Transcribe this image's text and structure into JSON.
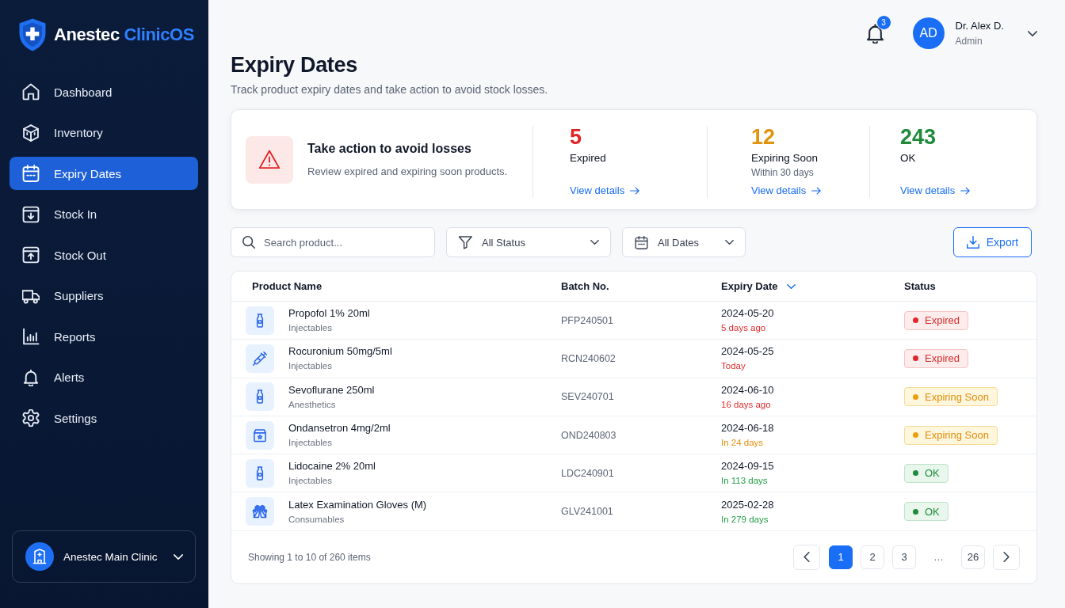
{
  "brand": {
    "name": "Anestec",
    "product": "ClinicOS"
  },
  "sidebar": {
    "items": [
      {
        "label": "Dashboard",
        "selected": false
      },
      {
        "label": "Inventory",
        "selected": false
      },
      {
        "label": "Expiry Dates",
        "selected": true
      },
      {
        "label": "Stock In",
        "selected": false
      },
      {
        "label": "Stock Out",
        "selected": false
      },
      {
        "label": "Suppliers",
        "selected": false
      },
      {
        "label": "Reports",
        "selected": false
      },
      {
        "label": "Alerts",
        "selected": false
      },
      {
        "label": "Settings",
        "selected": false
      }
    ],
    "clinic": {
      "name": "Anestec Main Clinic"
    }
  },
  "header": {
    "notifications": {
      "count": "3"
    },
    "user": {
      "initials": "AD",
      "name": "Dr. Alex D.",
      "role": "Admin"
    }
  },
  "page": {
    "title": "Expiry Dates",
    "subtitle": "Track product expiry dates and take action to avoid stock losses."
  },
  "alert": {
    "title": "Take action to avoid losses",
    "message": "Review expired and expiring soon products.",
    "stats": [
      {
        "kind": "expired",
        "value": "5",
        "label": "Expired",
        "link": "View details"
      },
      {
        "kind": "soon",
        "value": "12",
        "label": "Expiring Soon",
        "note": "Within 30 days",
        "link": "View details"
      },
      {
        "kind": "ok",
        "value": "243",
        "label": "OK",
        "link": "View details"
      }
    ]
  },
  "toolbar": {
    "search": {
      "placeholder": "Search product..."
    },
    "filters": [
      {
        "label": "All Status"
      },
      {
        "label": "All Dates"
      }
    ],
    "export": {
      "label": "Export"
    }
  },
  "table": {
    "columns": [
      {
        "label": "Product Name",
        "sorted": false
      },
      {
        "label": "Batch No.",
        "sorted": false
      },
      {
        "label": "Expiry Date",
        "sorted": true
      },
      {
        "label": "Status",
        "sorted": false
      }
    ],
    "rows": [
      {
        "name": "Propofol 1% 20ml",
        "category": "Injectables",
        "batch": "PFP240501",
        "expiry": {
          "date": "2024-05-20",
          "note": {
            "text": "5 days ago",
            "kind": "danger"
          }
        },
        "status": {
          "label": "Expired",
          "kind": "expired"
        }
      },
      {
        "name": "Rocuronium 50mg/5ml",
        "category": "Injectables",
        "batch": "RCN240602",
        "expiry": {
          "date": "2024-05-25",
          "note": {
            "text": "Today",
            "kind": "danger"
          }
        },
        "status": {
          "label": "Expired",
          "kind": "expired"
        }
      },
      {
        "name": "Sevoflurane 250ml",
        "category": "Anesthetics",
        "batch": "SEV240701",
        "expiry": {
          "date": "2024-06-10",
          "note": {
            "text": "16 days ago",
            "kind": "danger"
          }
        },
        "status": {
          "label": "Expiring Soon",
          "kind": "soon"
        }
      },
      {
        "name": "Ondansetron 4mg/2ml",
        "category": "Injectables",
        "batch": "OND240803",
        "expiry": {
          "date": "2024-06-18",
          "note": {
            "text": "In 24 days",
            "kind": "warning"
          }
        },
        "status": {
          "label": "Expiring Soon",
          "kind": "soon"
        }
      },
      {
        "name": "Lidocaine 2% 20ml",
        "category": "Injectables",
        "batch": "LDC240901",
        "expiry": {
          "date": "2024-09-15",
          "note": {
            "text": "In 113 days",
            "kind": "success"
          }
        },
        "status": {
          "label": "OK",
          "kind": "ok"
        }
      },
      {
        "name": "Latex Examination Gloves (M)",
        "category": "Consumables",
        "batch": "GLV241001",
        "expiry": {
          "date": "2025-02-28",
          "note": {
            "text": "In 279 days",
            "kind": "success"
          }
        },
        "status": {
          "label": "OK",
          "kind": "ok"
        }
      }
    ]
  },
  "pagination": {
    "summary": "Showing 1 to 10 of 260 items",
    "pages": [
      {
        "kind": "page",
        "label": "1",
        "selected": true
      },
      {
        "kind": "page",
        "label": "2",
        "selected": false
      },
      {
        "kind": "page",
        "label": "3",
        "selected": false
      },
      {
        "kind": "gap",
        "label": "…"
      },
      {
        "kind": "page",
        "label": "26",
        "selected": false
      }
    ]
  }
}
